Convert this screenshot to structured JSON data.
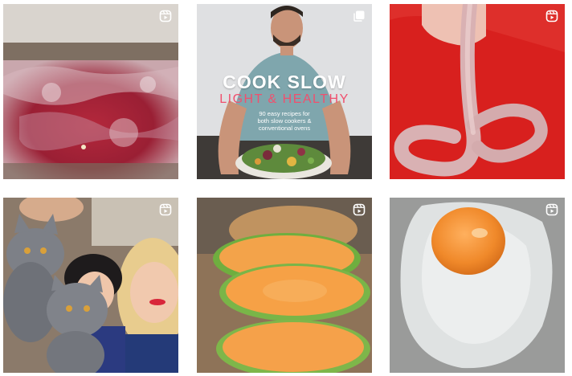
{
  "grid": {
    "posts": [
      {
        "type": "reel"
      },
      {
        "type": "carousel",
        "cover": {
          "title": "COOK SLOW",
          "subtitle": "LIGHT & HEALTHY",
          "tagline_line1": "90 easy recipes for",
          "tagline_line2": "both slow cookers &",
          "tagline_line3": "conventional ovens"
        }
      },
      {
        "type": "reel"
      },
      {
        "type": "reel"
      },
      {
        "type": "reel"
      },
      {
        "type": "reel"
      }
    ]
  },
  "colors": {
    "cover_title": "#ffffff",
    "cover_subtitle": "#f0506e",
    "tile_bg_red": "#d8201e"
  }
}
